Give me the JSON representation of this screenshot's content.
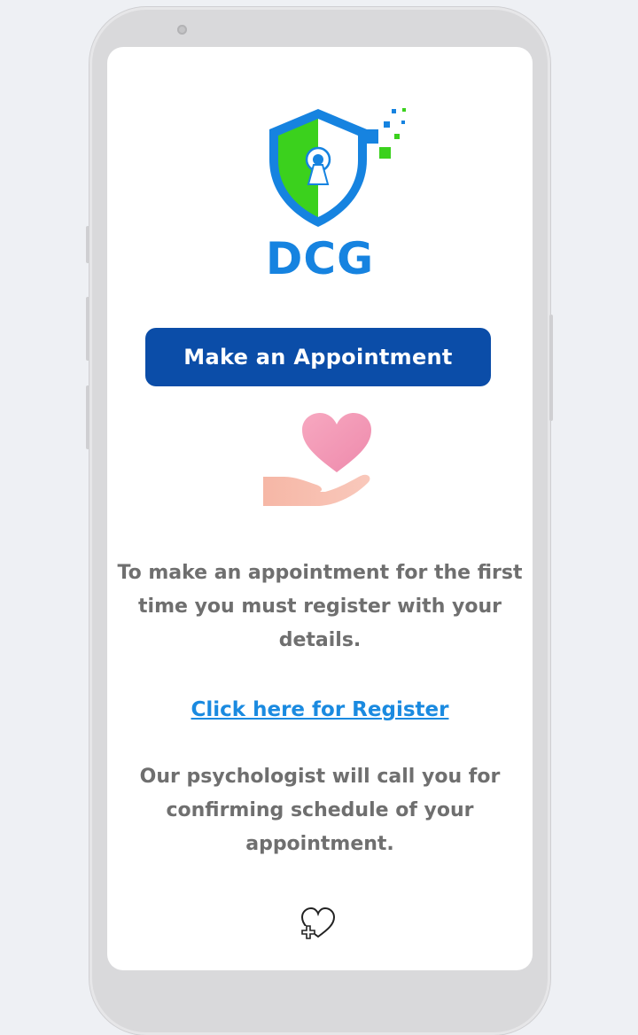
{
  "logo": {
    "text": "DCG",
    "icon": "shield-keyhole-icon"
  },
  "appointment_button": {
    "label": "Make an Appointment"
  },
  "illustration": {
    "icon": "hand-heart-icon"
  },
  "info_text": "To make an appointment for the first time you must register with your details.",
  "register_link": "Click here for Register",
  "call_text": "Our psychologist will call you for confirming schedule of your appointment.",
  "footer": {
    "icon": "heart-plus-icon"
  },
  "colors": {
    "brand_blue": "#1683e0",
    "button_blue": "#0b4da8",
    "shield_green": "#3bd11d",
    "link_blue": "#1a8ae0",
    "text_gray": "#6f6f6f",
    "heart_pink": "#f49ab6"
  }
}
